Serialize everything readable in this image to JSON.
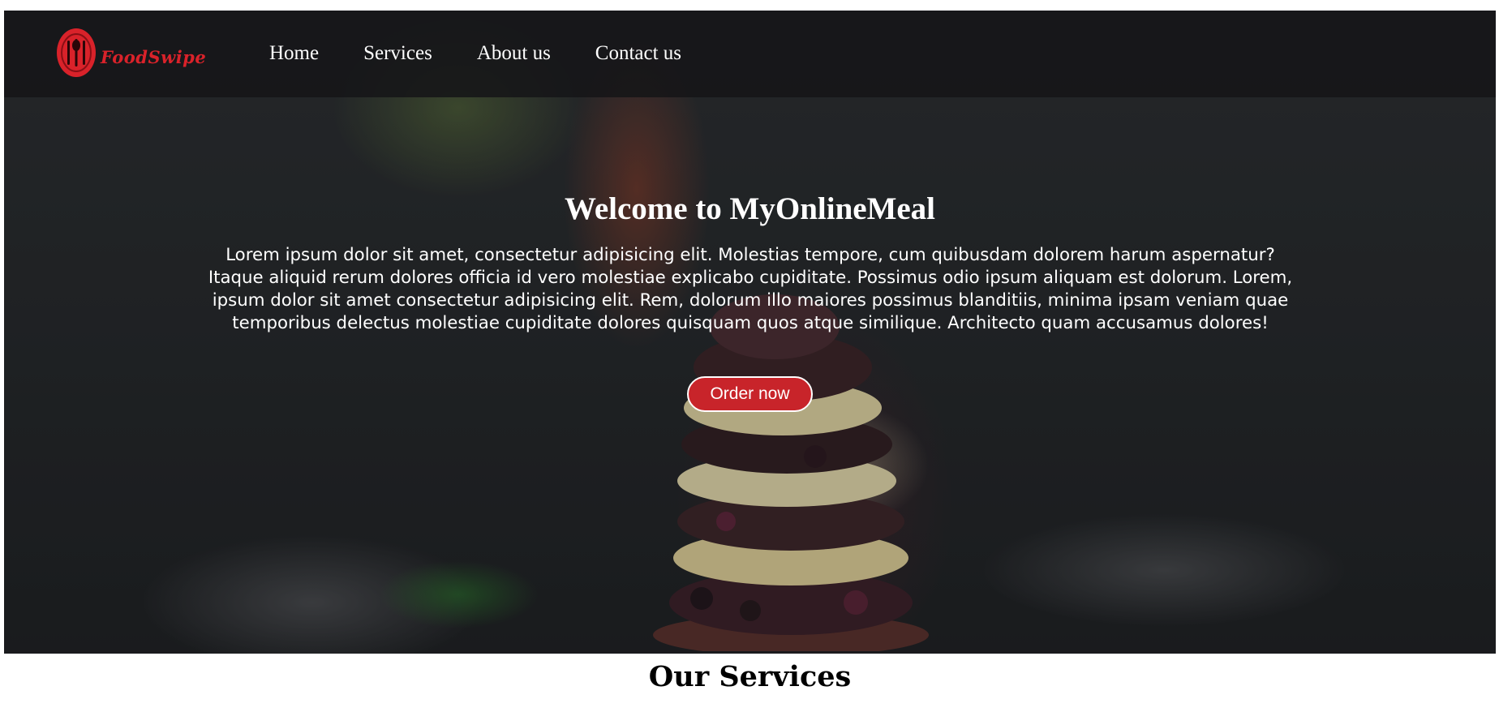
{
  "brand": {
    "name": "FoodSwipe",
    "logo_icon": "cutlery-plate-icon",
    "color": "#d9222a"
  },
  "nav": {
    "items": [
      {
        "label": "Home"
      },
      {
        "label": "Services"
      },
      {
        "label": "About us"
      },
      {
        "label": "Contact us"
      }
    ]
  },
  "hero": {
    "title": "Welcome to MyOnlineMeal",
    "text": "Lorem ipsum dolor sit amet, consectetur adipisicing elit. Molestias tempore, cum quibusdam dolorem harum aspernatur? Itaque aliquid rerum dolores officia id vero molestiae explicabo cupiditate. Possimus odio ipsum aliquam est dolorum. Lorem, ipsum dolor sit amet consectetur adipisicing elit. Rem, dolorum illo maiores possimus blanditiis, minima ipsam veniam quae temporibus delectus molestiae cupiditate dolores quisquam quos atque similique. Architecto quam accusamus dolores!",
    "cta_label": "Order now",
    "cta_color": "#c8242a",
    "background_image": "layered-berry-cake-photo"
  },
  "services": {
    "title": "Our Services"
  }
}
